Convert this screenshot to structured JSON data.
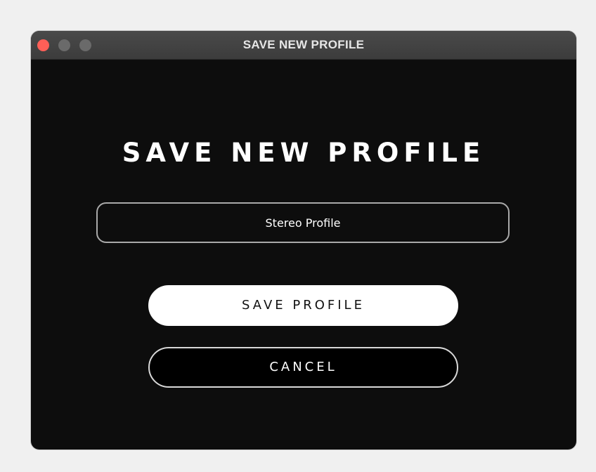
{
  "window": {
    "title": "SAVE NEW PROFILE"
  },
  "dialog": {
    "heading": "SAVE NEW PROFILE",
    "profile_name_value": "Stereo Profile",
    "save_label": "SAVE PROFILE",
    "cancel_label": "CANCEL"
  },
  "colors": {
    "close_button": "#ff5f57",
    "inactive_traffic": "#6a6a6a",
    "dialog_background": "#0d0d0d",
    "page_background": "#f0f0f0"
  }
}
